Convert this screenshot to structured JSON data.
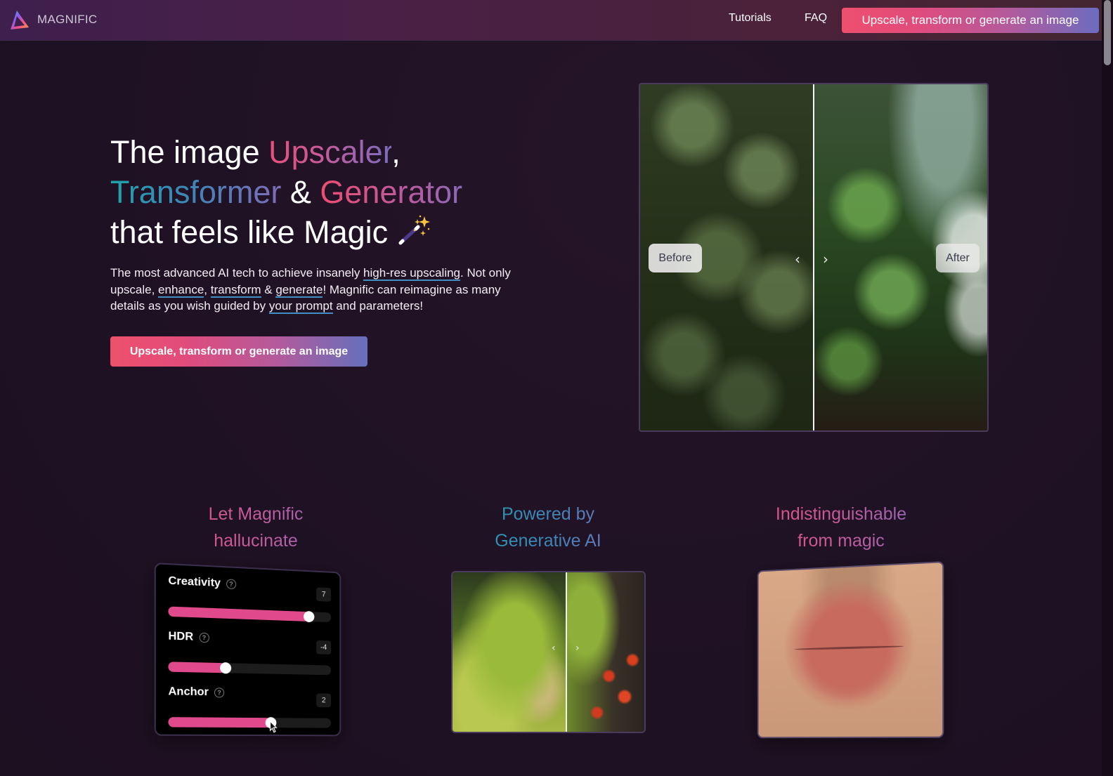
{
  "header": {
    "brand": "MAGNIFIC",
    "nav": [
      {
        "label": "Tutorials"
      },
      {
        "label": "FAQ"
      }
    ],
    "cta_label": "Upscale, transform or generate an image"
  },
  "hero": {
    "title": {
      "part1": "The image ",
      "upscaler": "Upscaler",
      "comma": ",",
      "transformer": "Transformer",
      "amp": " & ",
      "generator": "Generator",
      "line3": "that feels like Magic",
      "emoji_icon": "magic-wand-icon"
    },
    "description": {
      "t1": "The most advanced AI tech to achieve insanely ",
      "link_upscaling": "high-res upscaling",
      "t2": ". Not only upscale, ",
      "link_enhance": "enhance",
      "t3": ", ",
      "link_transform": "transform",
      "t4": " & ",
      "link_generate": "generate",
      "t5": "! Magnific can reimagine as many details as you wish guided by ",
      "link_prompt": "your prompt",
      "t6": " and parameters!"
    },
    "cta_label": "Upscale, transform or generate an image"
  },
  "comparison": {
    "before_label": "Before",
    "after_label": "After",
    "slider_position": 0.5
  },
  "features": [
    {
      "title_line1": "Let Magnific",
      "title_line2": "hallucinate",
      "sliders": [
        {
          "label": "Creativity",
          "value": "7",
          "fill": 0.86
        },
        {
          "label": "HDR",
          "value": "-4",
          "fill": 0.34
        },
        {
          "label": "Anchor",
          "value": "2",
          "fill": 0.62
        }
      ]
    },
    {
      "title_line1": "Powered by",
      "title_line2": "Generative AI",
      "slider_position": 0.59
    },
    {
      "title_line1": "Indistinguishable",
      "title_line2": "from magic"
    }
  ],
  "colors": {
    "background": "#1f1124",
    "accent_pink": "#e04a8c",
    "accent_red": "#ee4f6d",
    "accent_blue": "#6c6cc0",
    "link_underline": "#3f8fc2"
  }
}
